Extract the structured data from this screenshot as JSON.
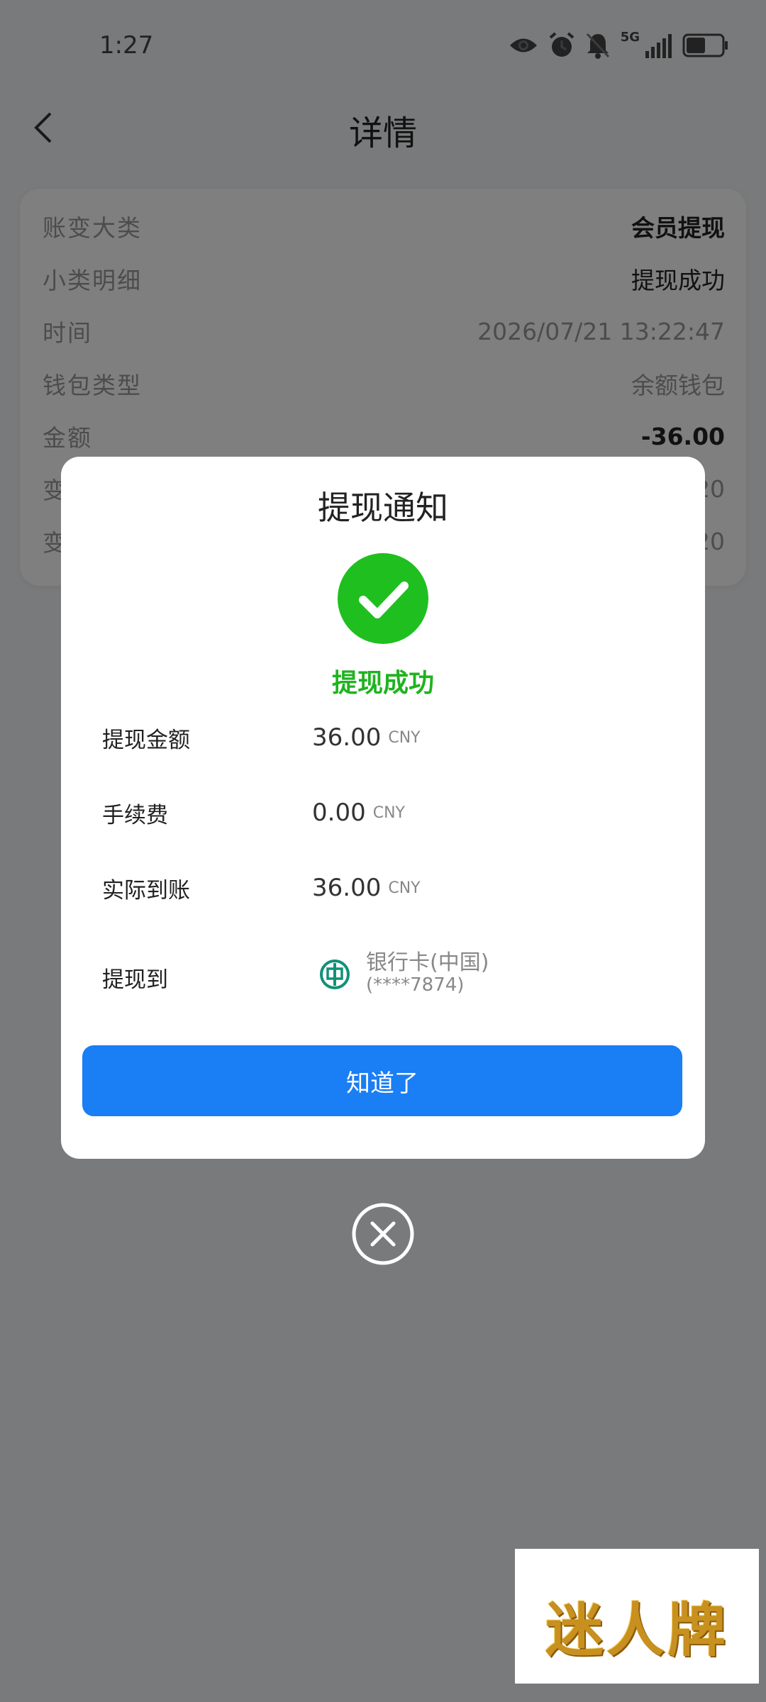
{
  "status_bar": {
    "time": "1:27",
    "network": "5G",
    "battery": "53"
  },
  "header": {
    "title": "详情"
  },
  "details": [
    {
      "label": "账变大类",
      "value": "会员提现"
    },
    {
      "label": "小类明细",
      "value": "提现成功"
    },
    {
      "label": "时间",
      "value": "2026/07/21 13:22:47"
    },
    {
      "label": "钱包类型",
      "value": "余额钱包"
    },
    {
      "label": "金额",
      "value": "-36.00"
    },
    {
      "label": "变",
      "value": "20"
    },
    {
      "label": "变",
      "value": "20"
    }
  ],
  "modal": {
    "title": "提现通知",
    "status": "提现成功",
    "rows": [
      {
        "label": "提现金额",
        "amount": "36.00",
        "unit": "CNY"
      },
      {
        "label": "手续费",
        "amount": "0.00",
        "unit": "CNY"
      },
      {
        "label": "实际到账",
        "amount": "36.00",
        "unit": "CNY"
      }
    ],
    "bank": {
      "label": "提现到",
      "name": "银行卡(中国)",
      "number": "(****7874)"
    },
    "button_label": "知道了"
  },
  "watermark": "迷人牌",
  "colors": {
    "success_green": "#1fb31f",
    "primary_blue": "#1a7ef5",
    "bank_green": "#12907a"
  }
}
